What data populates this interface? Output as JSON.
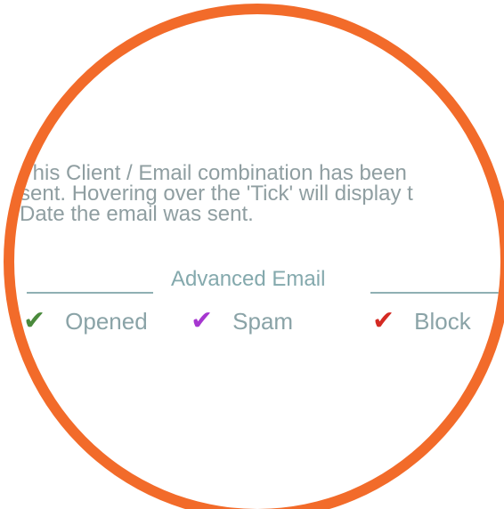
{
  "description": "This Client / Email combination has been\nsent.  Hovering over the 'Tick' will display t\nDate the email was sent.",
  "section_title": "Advanced Email",
  "legend": [
    {
      "icon": "check-mark-icon",
      "glyph": "✔",
      "color": "#4a8a3c",
      "label": "Opened"
    },
    {
      "icon": "check-mark-icon",
      "glyph": "✔",
      "color": "#a636d0",
      "label": "Spam"
    },
    {
      "icon": "check-mark-icon",
      "glyph": "✔",
      "color": "#d42a23",
      "label": "Block"
    }
  ],
  "colors": {
    "ring": "#f26b2a",
    "text": "#8f9ea1",
    "divider": "#8fb0b3"
  }
}
